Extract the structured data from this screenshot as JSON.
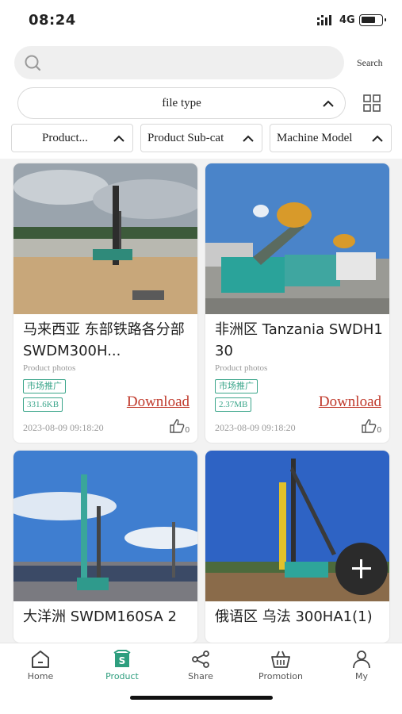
{
  "status": {
    "time": "08:24",
    "network": "4G"
  },
  "search": {
    "placeholder": "",
    "button_label": "Search"
  },
  "filters": {
    "file_type": "file type",
    "product_category": "Product...",
    "product_subcategory": "Product Sub-cat",
    "machine_model": "Machine Model"
  },
  "cards": [
    {
      "title": "马来西亚 东部铁路各分部 SWDM300H...",
      "category": "Product photos",
      "tag": "市场推广",
      "size": "331.6KB",
      "download": "Download",
      "date": "2023-08-09 09:18:20",
      "likes": "0"
    },
    {
      "title": "非洲区 Tanzania SWDH130",
      "category": "Product photos",
      "tag": "市场推广",
      "size": "2.37MB",
      "download": "Download",
      "date": "2023-08-09 09:18:20",
      "likes": "0"
    },
    {
      "title": "大洋洲 SWDM160SA 2"
    },
    {
      "title": "俄语区 乌法 300HA1(1)"
    }
  ],
  "tabs": [
    {
      "label": "Home",
      "icon": "home-icon"
    },
    {
      "label": "Product",
      "icon": "product-icon",
      "active": true
    },
    {
      "label": "Share",
      "icon": "share-icon"
    },
    {
      "label": "Promotion",
      "icon": "basket-icon"
    },
    {
      "label": "My",
      "icon": "user-icon"
    }
  ],
  "colors": {
    "accent": "#2e9e7e",
    "download": "#c0392b",
    "fab": "#2b2b2b"
  }
}
